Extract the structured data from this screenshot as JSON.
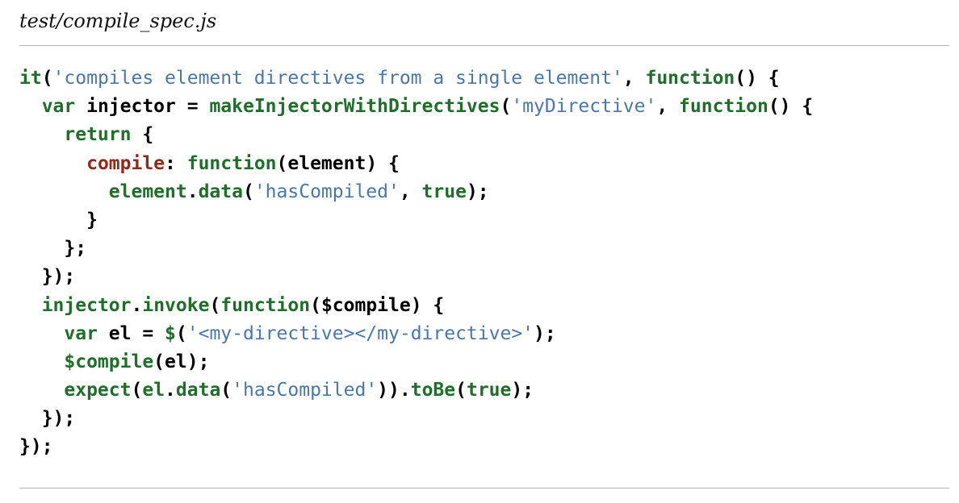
{
  "document": {
    "filename": "test/compile_spec.js"
  },
  "code_lines": [
    [
      {
        "t": "fn",
        "v": "it"
      },
      {
        "t": "punc",
        "v": "("
      },
      {
        "t": "str",
        "v": "'compiles element directives from a single element'"
      },
      {
        "t": "punc",
        "v": ", "
      },
      {
        "t": "kw",
        "v": "function"
      },
      {
        "t": "punc",
        "v": "() {"
      }
    ],
    [
      {
        "t": "punc",
        "v": "  "
      },
      {
        "t": "kw",
        "v": "var"
      },
      {
        "t": "var",
        "v": " injector "
      },
      {
        "t": "punc",
        "v": "= "
      },
      {
        "t": "fn",
        "v": "makeInjectorWithDirectives"
      },
      {
        "t": "punc",
        "v": "("
      },
      {
        "t": "str",
        "v": "'myDirective'"
      },
      {
        "t": "punc",
        "v": ", "
      },
      {
        "t": "kw",
        "v": "function"
      },
      {
        "t": "punc",
        "v": "() {"
      }
    ],
    [
      {
        "t": "punc",
        "v": "    "
      },
      {
        "t": "kw",
        "v": "return"
      },
      {
        "t": "punc",
        "v": " {"
      }
    ],
    [
      {
        "t": "punc",
        "v": "      "
      },
      {
        "t": "prop",
        "v": "compile"
      },
      {
        "t": "punc",
        "v": ": "
      },
      {
        "t": "kw",
        "v": "function"
      },
      {
        "t": "punc",
        "v": "("
      },
      {
        "t": "var",
        "v": "element"
      },
      {
        "t": "punc",
        "v": ") {"
      }
    ],
    [
      {
        "t": "punc",
        "v": "        "
      },
      {
        "t": "fn",
        "v": "element"
      },
      {
        "t": "punc",
        "v": "."
      },
      {
        "t": "fn",
        "v": "data"
      },
      {
        "t": "punc",
        "v": "("
      },
      {
        "t": "str",
        "v": "'hasCompiled'"
      },
      {
        "t": "punc",
        "v": ", "
      },
      {
        "t": "kw",
        "v": "true"
      },
      {
        "t": "punc",
        "v": ");"
      }
    ],
    [
      {
        "t": "punc",
        "v": "      }"
      }
    ],
    [
      {
        "t": "punc",
        "v": "    };"
      }
    ],
    [
      {
        "t": "punc",
        "v": "  });"
      }
    ],
    [
      {
        "t": "punc",
        "v": "  "
      },
      {
        "t": "fn",
        "v": "injector"
      },
      {
        "t": "punc",
        "v": "."
      },
      {
        "t": "fn",
        "v": "invoke"
      },
      {
        "t": "punc",
        "v": "("
      },
      {
        "t": "kw",
        "v": "function"
      },
      {
        "t": "punc",
        "v": "("
      },
      {
        "t": "var",
        "v": "$compile"
      },
      {
        "t": "punc",
        "v": ") {"
      }
    ],
    [
      {
        "t": "punc",
        "v": "    "
      },
      {
        "t": "kw",
        "v": "var"
      },
      {
        "t": "var",
        "v": " el "
      },
      {
        "t": "punc",
        "v": "= "
      },
      {
        "t": "fn",
        "v": "$"
      },
      {
        "t": "punc",
        "v": "("
      },
      {
        "t": "str",
        "v": "'<my-directive></my-directive>'"
      },
      {
        "t": "punc",
        "v": ");"
      }
    ],
    [
      {
        "t": "punc",
        "v": "    "
      },
      {
        "t": "fn",
        "v": "$compile"
      },
      {
        "t": "punc",
        "v": "("
      },
      {
        "t": "var",
        "v": "el"
      },
      {
        "t": "punc",
        "v": ");"
      }
    ],
    [
      {
        "t": "punc",
        "v": "    "
      },
      {
        "t": "fn",
        "v": "expect"
      },
      {
        "t": "punc",
        "v": "("
      },
      {
        "t": "fn",
        "v": "el"
      },
      {
        "t": "punc",
        "v": "."
      },
      {
        "t": "fn",
        "v": "data"
      },
      {
        "t": "punc",
        "v": "("
      },
      {
        "t": "str",
        "v": "'hasCompiled'"
      },
      {
        "t": "punc",
        "v": "))."
      },
      {
        "t": "fn",
        "v": "toBe"
      },
      {
        "t": "punc",
        "v": "("
      },
      {
        "t": "kw",
        "v": "true"
      },
      {
        "t": "punc",
        "v": ");"
      }
    ],
    [
      {
        "t": "punc",
        "v": "  });"
      }
    ],
    [
      {
        "t": "punc",
        "v": "});"
      }
    ]
  ],
  "colors": {
    "keyword": "#1f6e2a",
    "string": "#4a77aa",
    "property": "#922a1c",
    "text": "#000000",
    "rule": "#b5b5b5"
  }
}
